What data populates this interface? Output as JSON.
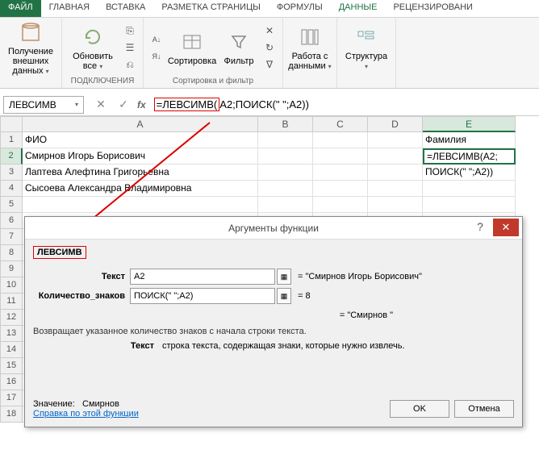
{
  "tabs": {
    "file": "ФАЙЛ",
    "home": "ГЛАВНАЯ",
    "insert": "ВСТАВКА",
    "layout": "РАЗМЕТКА СТРАНИЦЫ",
    "formulas": "ФОРМУЛЫ",
    "data": "ДАННЫЕ",
    "review": "РЕЦЕНЗИРОВАНИ"
  },
  "ribbon": {
    "getData": "Получение",
    "getData2": "внешних данных",
    "refresh": "Обновить",
    "refresh2": "все",
    "conn": "ПОДКЛЮЧЕНИЯ",
    "sort": "Сортировка",
    "filter": "Фильтр",
    "sortFilter": "Сортировка и фильтр",
    "dataTools": "Работа с",
    "dataTools2": "данными",
    "outline": "Структура"
  },
  "nameBox": "ЛЕВСИМВ",
  "formulaHL": "=ЛЕВСИМВ(",
  "formulaRest": "A2;ПОИСК(\" \";A2))",
  "cells": {
    "a1": "ФИО",
    "e1": "Фамилия",
    "a2": "Смирнов Игорь Борисович",
    "e2": "=ЛЕВСИМВ(A2;",
    "a3": "Лаптева Алефтина Григорьевна",
    "e3": "ПОИСК(\" \";A2))",
    "a4": "Сысоева Александра Владимировна"
  },
  "dialog": {
    "title": "Аргументы функции",
    "func": "ЛЕВСИМВ",
    "arg1": "Текст",
    "val1": "A2",
    "res1": "= \"Смирнов Игорь Борисович\"",
    "arg2": "Количество_знаков",
    "val2": "ПОИСК(\" \";A2)",
    "res2": "= 8",
    "resultEq": "= \"Смирнов \"",
    "desc": "Возвращает указанное количество знаков с начала строки текста.",
    "paramName": "Текст",
    "paramDesc": "строка текста, содержащая знаки, которые нужно извлечь.",
    "valueLbl": "Значение:",
    "valueRes": "Смирнов",
    "help": "Справка по этой функции",
    "ok": "OK",
    "cancel": "Отмена"
  }
}
